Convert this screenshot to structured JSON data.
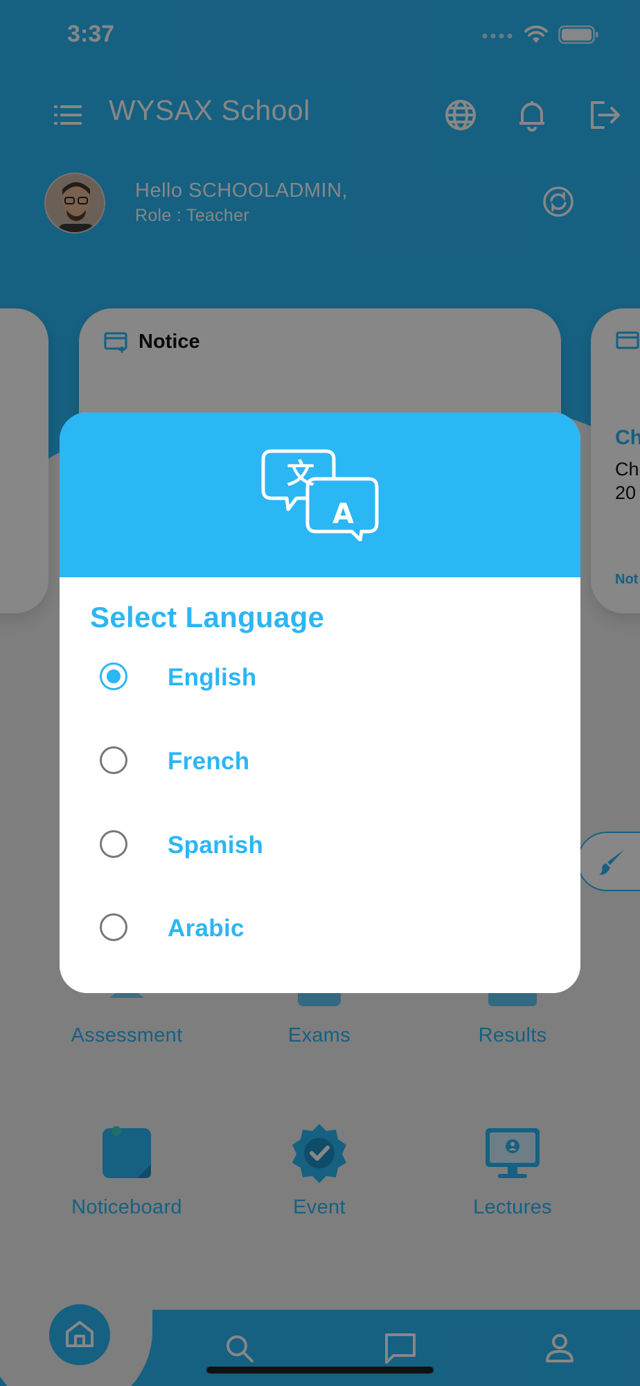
{
  "status_bar": {
    "time": "3:37"
  },
  "header": {
    "title": "WYSAX School"
  },
  "profile": {
    "greeting": "Hello SCHOOLADMIN,",
    "role": "Role : Teacher"
  },
  "cards": {
    "main_title": "Notice",
    "right_title": "Ch",
    "right_text_line1": "Ch",
    "right_text_line2": "20",
    "right_link": "Not"
  },
  "grid": {
    "row1": [
      {
        "label": "Assessment"
      },
      {
        "label": "Exams"
      },
      {
        "label": "Results"
      }
    ],
    "row2": [
      {
        "label": "Noticeboard"
      },
      {
        "label": "Event"
      },
      {
        "label": "Lectures"
      }
    ]
  },
  "dialog": {
    "title": "Select Language",
    "options": [
      {
        "label": "English",
        "selected": true
      },
      {
        "label": "French",
        "selected": false
      },
      {
        "label": "Spanish",
        "selected": false
      },
      {
        "label": "Arabic",
        "selected": false
      }
    ]
  },
  "colors": {
    "accent": "#2bb6f4",
    "overlay": "rgba(0,0,0,0.47)"
  },
  "icons": {
    "menu": "menu-icon",
    "language": "globe-icon",
    "notifications": "bell-icon",
    "logout": "logout-icon",
    "switch_role": "refresh-icon",
    "translate": "translate-icon",
    "home": "home-icon",
    "search": "search-icon",
    "chat": "chat-icon",
    "profile": "person-icon"
  }
}
